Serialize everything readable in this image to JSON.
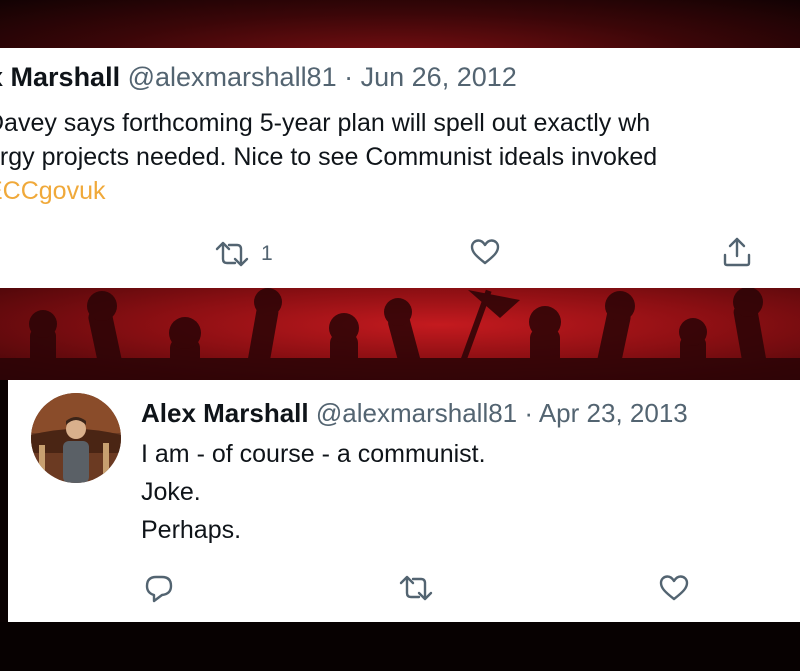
{
  "tweet1": {
    "name": "ex Marshall",
    "handle": "@alexmarshall81",
    "separator": "·",
    "date": "Jun 26, 2012",
    "lines": [
      "Davey says forthcoming 5-year plan will spell out exactly wh",
      "ergy projects needed. Nice to see Communist ideals invoked"
    ],
    "link": "ECCgovuk",
    "retweet_count": "1"
  },
  "tweet2": {
    "name": "Alex Marshall",
    "handle": "@alexmarshall81",
    "separator": "·",
    "date": "Apr 23, 2013",
    "lines": [
      "I am - of course - a communist.",
      "Joke.",
      "Perhaps."
    ]
  },
  "colors": {
    "link": "#f0a93a",
    "secondary_text": "#536471",
    "primary_text": "#0f1419",
    "banner_red": "#b5151a"
  },
  "icons": [
    "retweet-icon",
    "heart-icon",
    "share-icon",
    "reply-icon"
  ]
}
